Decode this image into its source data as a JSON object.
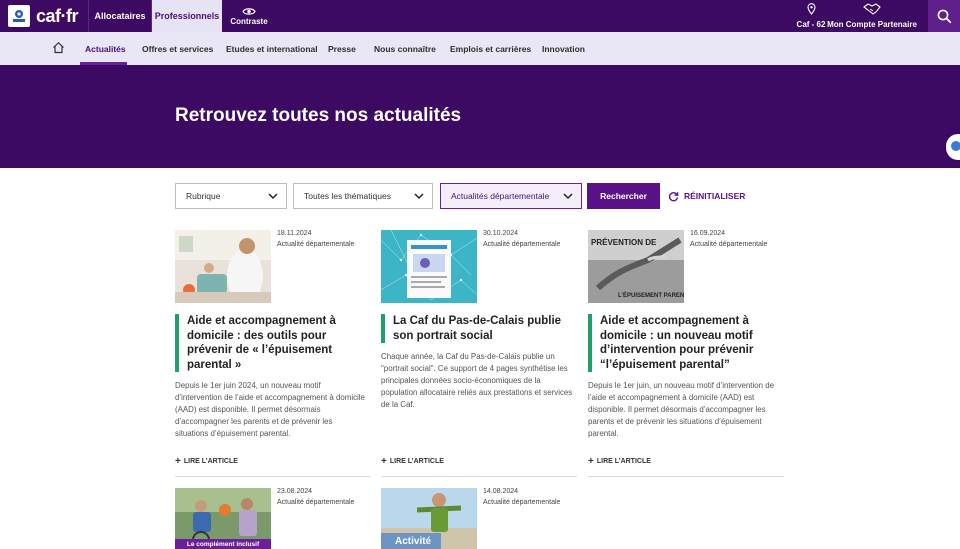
{
  "header": {
    "logo_text": "caf·fr",
    "tab_allocataires": "Allocataires",
    "tab_professionnels": "Professionnels",
    "tab_contraste": "Contraste",
    "caf_location": "Caf - 62",
    "compte_label": "Mon Compte Partenaire",
    "accent_color": "#3d0a63"
  },
  "nav": {
    "items": [
      "Actualités",
      "Offres et services",
      "Etudes et international",
      "Presse",
      "Nous connaître",
      "Emplois et carrières",
      "Innovation"
    ],
    "active": "Actualités"
  },
  "hero": {
    "title": "Retrouvez toutes nos actualités"
  },
  "filters": {
    "rubrique": "Rubrique",
    "thematiques": "Toutes les thématiques",
    "actualites": "Actualités départementale",
    "search_label": "Rechercher",
    "reset_label": "RÉINITIALISER"
  },
  "cards": [
    {
      "date": "18.11.2024",
      "category": "Actualité départementale",
      "title": "Aide et accompagnement à domicile : des outils pour prévenir de « l’épuisement parental »",
      "description": "Depuis le 1er juin 2024, un nouveau motif d’intervention de l’aide et accompagnement à domicile (AAD) est disponible. Il permet désormais d’accompagner les parents et de prévenir les situations d’épuisement parental.",
      "more": "LIRE L’ARTICLE"
    },
    {
      "date": "30.10.2024",
      "category": "Actualité départementale",
      "title": "La Caf du Pas-de-Calais publie son portrait social",
      "description": "Chaque année, la Caf du Pas-de-Calais publie un \"portrait social\". Ce support de 4 pages synthétise les principales données socio-économiques de la population allocataire reliés aux prestations et services de la Caf.",
      "more": "LIRE L’ARTICLE"
    },
    {
      "date": "16.09.2024",
      "category": "Actualité départementale",
      "title": "Aide et accompagnement à domicile : un nouveau motif d’intervention pour prévenir “l’épuisement parental”",
      "description": "Depuis le 1er juin, un nouveau motif d’intervention de l’aide et accompagnement à domicile (AAD) est disponible. Il permet désormais d’accompagner les parents et de prévenir les situations d’épuisement parental.",
      "more": "LIRE L’ARTICLE",
      "image_text_top": "PRÉVENTION DE",
      "image_text_bottom": "L’ÉPUISEMENT PARENTAL"
    },
    {
      "date": "23.08.2024",
      "category": "Actualité départementale",
      "image_badge": "Le complément inclusif"
    },
    {
      "date": "14.08.2024",
      "category": "Actualité départementale",
      "image_badge": "Activité"
    }
  ]
}
